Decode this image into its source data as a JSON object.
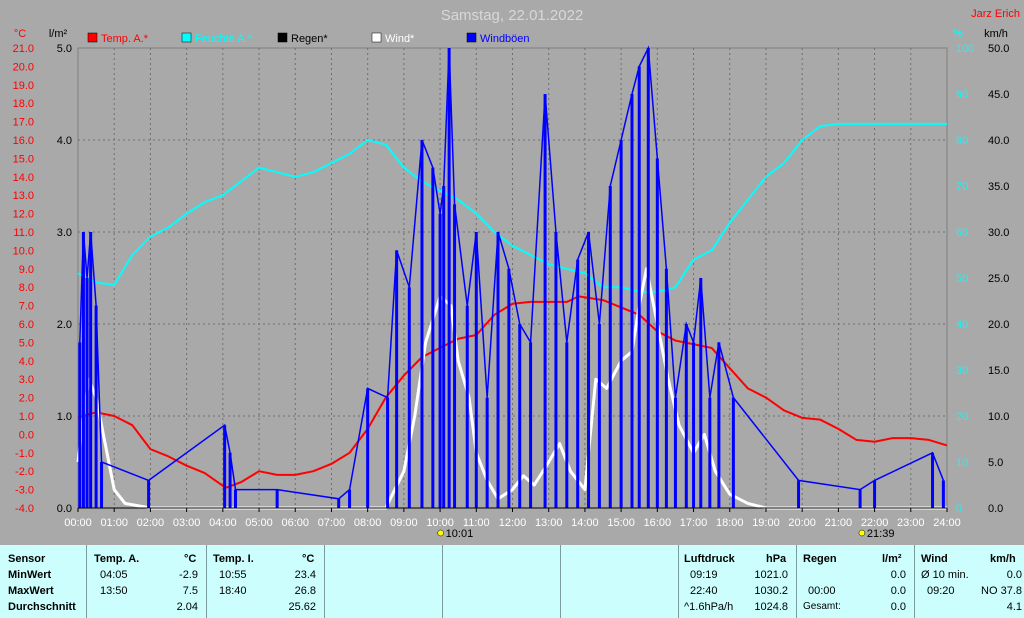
{
  "title": "Samstag, 22.01.2022",
  "author": "Jarz Erich",
  "colors": {
    "background": "#a9a9a9",
    "temperature": "#ff0000",
    "humidity": "#00ffff",
    "rain": "#000000",
    "wind": "#ffffff",
    "gusts": "#0000ff",
    "table": "#ccfefe"
  },
  "axes": {
    "temp_unit": "°C",
    "rain_unit": "l/m²",
    "humidity_unit": "%",
    "wind_unit": "km/h",
    "temp_ticks": [
      "21.0",
      "20.0",
      "19.0",
      "18.0",
      "17.0",
      "16.0",
      "15.0",
      "14.0",
      "13.0",
      "12.0",
      "11.0",
      "10.0",
      "9.0",
      "8.0",
      "7.0",
      "6.0",
      "5.0",
      "4.0",
      "3.0",
      "2.0",
      "1.0",
      "0.0",
      "-1.0",
      "-2.0",
      "-3.0",
      "-4.0"
    ],
    "rain_ticks": [
      "5.0",
      "4.0",
      "3.0",
      "2.0",
      "1.0",
      "0.0"
    ],
    "humidity_ticks": [
      "100",
      "90",
      "80",
      "70",
      "60",
      "50",
      "40",
      "30",
      "20",
      "10",
      "0"
    ],
    "wind_ticks": [
      "50.0",
      "45.0",
      "40.0",
      "35.0",
      "30.0",
      "25.0",
      "20.0",
      "15.0",
      "10.0",
      "5.0",
      "0.0"
    ],
    "time_ticks": [
      "00:00",
      "01:00",
      "02:00",
      "03:00",
      "04:00",
      "05:00",
      "06:00",
      "07:00",
      "08:00",
      "09:00",
      "10:00",
      "11:00",
      "12:00",
      "13:00",
      "14:00",
      "15:00",
      "16:00",
      "17:00",
      "18:00",
      "19:00",
      "20:00",
      "21:00",
      "22:00",
      "23:00",
      "24:00"
    ]
  },
  "markers": {
    "sunrise": "10:01",
    "sunset": "21:39"
  },
  "chart_data": {
    "type": "line",
    "title": "Samstag, 22.01.2022",
    "x_range_hours": [
      0,
      24
    ],
    "ylim_temp": [
      -4,
      21
    ],
    "ylim_rain": [
      0,
      5
    ],
    "ylim_humidity": [
      0,
      100
    ],
    "ylim_wind": [
      0,
      50
    ],
    "grid": true,
    "legend": "top",
    "series": [
      {
        "name": "Temp. A.*",
        "axis": "temp",
        "color": "#ff0000",
        "points": [
          [
            0,
            0.9
          ],
          [
            0.3,
            1.1
          ],
          [
            0.5,
            1.2
          ],
          [
            1,
            1.0
          ],
          [
            1.5,
            0.5
          ],
          [
            2,
            -0.8
          ],
          [
            2.5,
            -1.2
          ],
          [
            3,
            -1.7
          ],
          [
            3.5,
            -2.1
          ],
          [
            4.08,
            -2.9
          ],
          [
            4.5,
            -2.6
          ],
          [
            5,
            -2.0
          ],
          [
            5.5,
            -2.2
          ],
          [
            6,
            -2.2
          ],
          [
            6.5,
            -2.0
          ],
          [
            7,
            -1.6
          ],
          [
            7.5,
            -1.0
          ],
          [
            8,
            0.3
          ],
          [
            8.5,
            2.0
          ],
          [
            9,
            3.2
          ],
          [
            9.5,
            4.2
          ],
          [
            10,
            4.7
          ],
          [
            10.5,
            5.2
          ],
          [
            11,
            5.4
          ],
          [
            11.5,
            6.5
          ],
          [
            12,
            7.1
          ],
          [
            12.5,
            7.2
          ],
          [
            13,
            7.2
          ],
          [
            13.5,
            7.2
          ],
          [
            13.83,
            7.5
          ],
          [
            14.5,
            7.3
          ],
          [
            15,
            6.9
          ],
          [
            15.5,
            6.5
          ],
          [
            16,
            5.6
          ],
          [
            16.5,
            5.1
          ],
          [
            17,
            4.9
          ],
          [
            17.5,
            4.7
          ],
          [
            18,
            3.6
          ],
          [
            18.5,
            2.5
          ],
          [
            19,
            2.0
          ],
          [
            19.5,
            1.3
          ],
          [
            20,
            0.9
          ],
          [
            20.5,
            0.8
          ],
          [
            21,
            0.3
          ],
          [
            21.5,
            -0.3
          ],
          [
            22,
            -0.4
          ],
          [
            22.5,
            -0.2
          ],
          [
            23,
            -0.2
          ],
          [
            23.5,
            -0.3
          ],
          [
            24,
            -0.6
          ]
        ]
      },
      {
        "name": "Feuchte A.*",
        "axis": "humidity",
        "color": "#00ffff",
        "points": [
          [
            0,
            51
          ],
          [
            0.5,
            49
          ],
          [
            1,
            48.5
          ],
          [
            1.5,
            55
          ],
          [
            2,
            59
          ],
          [
            2.5,
            61
          ],
          [
            3,
            64
          ],
          [
            3.5,
            66.5
          ],
          [
            4,
            68
          ],
          [
            4.5,
            71
          ],
          [
            5,
            74
          ],
          [
            5.5,
            73
          ],
          [
            6,
            72
          ],
          [
            6.5,
            73
          ],
          [
            7,
            75
          ],
          [
            7.5,
            77
          ],
          [
            8,
            80
          ],
          [
            8.5,
            79
          ],
          [
            9,
            74
          ],
          [
            9.5,
            71
          ],
          [
            10,
            69
          ],
          [
            10.5,
            67
          ],
          [
            11,
            64
          ],
          [
            11.5,
            60
          ],
          [
            12,
            57
          ],
          [
            12.5,
            55
          ],
          [
            13,
            53
          ],
          [
            13.5,
            52
          ],
          [
            14,
            51
          ],
          [
            14.5,
            48
          ],
          [
            15,
            48
          ],
          [
            15.5,
            47
          ],
          [
            16,
            47
          ],
          [
            16.5,
            48
          ],
          [
            17,
            54
          ],
          [
            17.5,
            56
          ],
          [
            18,
            62
          ],
          [
            18.5,
            67
          ],
          [
            19,
            72
          ],
          [
            19.5,
            75
          ],
          [
            20,
            80
          ],
          [
            20.5,
            83
          ],
          [
            21,
            83.5
          ],
          [
            22,
            83.5
          ],
          [
            23,
            83.5
          ],
          [
            24,
            83.5
          ]
        ]
      },
      {
        "name": "Wind*",
        "axis": "wind",
        "color": "#ffffff",
        "points": [
          [
            0,
            5.0
          ],
          [
            0.15,
            10
          ],
          [
            0.3,
            14
          ],
          [
            0.5,
            12
          ],
          [
            0.7,
            8
          ],
          [
            1,
            2
          ],
          [
            1.3,
            0.5
          ],
          [
            2,
            0
          ],
          [
            8.5,
            0
          ],
          [
            9,
            4
          ],
          [
            9.3,
            10
          ],
          [
            9.6,
            18
          ],
          [
            10,
            23
          ],
          [
            10.3,
            22
          ],
          [
            10.5,
            16
          ],
          [
            10.8,
            12
          ],
          [
            11,
            6
          ],
          [
            11.3,
            3
          ],
          [
            11.6,
            1
          ],
          [
            12,
            2
          ],
          [
            12.3,
            3.5
          ],
          [
            12.6,
            2.5
          ],
          [
            13,
            5
          ],
          [
            13.3,
            7
          ],
          [
            13.6,
            4
          ],
          [
            14,
            2
          ],
          [
            14.3,
            14
          ],
          [
            14.6,
            13
          ],
          [
            15,
            16
          ],
          [
            15.3,
            17
          ],
          [
            15.5,
            22
          ],
          [
            15.7,
            26
          ],
          [
            16,
            20
          ],
          [
            16.3,
            14
          ],
          [
            16.6,
            9
          ],
          [
            17,
            6
          ],
          [
            17.3,
            8
          ],
          [
            17.6,
            4
          ],
          [
            18,
            1.5
          ],
          [
            18.5,
            0.5
          ],
          [
            19,
            0
          ],
          [
            24,
            0
          ]
        ]
      },
      {
        "name": "Windböen",
        "axis": "wind",
        "color": "#0000ff",
        "bars": [
          [
            0.05,
            18
          ],
          [
            0.15,
            30
          ],
          [
            0.25,
            25
          ],
          [
            0.35,
            30
          ],
          [
            0.5,
            22
          ],
          [
            0.65,
            5
          ],
          [
            1.95,
            3
          ],
          [
            4.05,
            9
          ],
          [
            4.2,
            6
          ],
          [
            4.35,
            2
          ],
          [
            5.5,
            2
          ],
          [
            7.2,
            1
          ],
          [
            7.5,
            2
          ],
          [
            8,
            13
          ],
          [
            8.55,
            12
          ],
          [
            8.8,
            28
          ],
          [
            9.15,
            24
          ],
          [
            9.5,
            40
          ],
          [
            9.8,
            37
          ],
          [
            10,
            32
          ],
          [
            10.1,
            35
          ],
          [
            10.25,
            50
          ],
          [
            10.4,
            33
          ],
          [
            10.75,
            22
          ],
          [
            11,
            30
          ],
          [
            11.3,
            12
          ],
          [
            11.6,
            30
          ],
          [
            11.9,
            26
          ],
          [
            12.2,
            20
          ],
          [
            12.5,
            18
          ],
          [
            12.9,
            45
          ],
          [
            13.2,
            30
          ],
          [
            13.5,
            18
          ],
          [
            13.8,
            27
          ],
          [
            14.1,
            30
          ],
          [
            14.4,
            20
          ],
          [
            14.7,
            35
          ],
          [
            15,
            40
          ],
          [
            15.3,
            45
          ],
          [
            15.5,
            48
          ],
          [
            15.75,
            50
          ],
          [
            16,
            38
          ],
          [
            16.25,
            26
          ],
          [
            16.5,
            12
          ],
          [
            16.8,
            20
          ],
          [
            17,
            18
          ],
          [
            17.2,
            25
          ],
          [
            17.45,
            12
          ],
          [
            17.7,
            18
          ],
          [
            18.1,
            12
          ],
          [
            19.9,
            3
          ],
          [
            21.6,
            2
          ],
          [
            22,
            3
          ],
          [
            23.6,
            6
          ],
          [
            23.9,
            3
          ]
        ]
      },
      {
        "name": "Regen*",
        "axis": "rain",
        "color": "#000000",
        "points": [
          [
            0,
            0
          ],
          [
            24,
            0
          ]
        ]
      }
    ]
  },
  "table": {
    "sensor": {
      "header": "Sensor",
      "min": "MinWert",
      "max": "MaxWert",
      "avg": "Durchschnitt"
    },
    "temp_a": {
      "header": "Temp. A.",
      "unit": "°C",
      "min_time": "04:05",
      "min_val": "-2.9",
      "max_time": "13:50",
      "max_val": "7.5",
      "avg": "2.04"
    },
    "temp_i": {
      "header": "Temp. I.",
      "unit": "°C",
      "min_time": "10:55",
      "min_val": "23.4",
      "max_time": "18:40",
      "max_val": "26.8",
      "avg": "25.62"
    },
    "pressure": {
      "header": "Luftdruck",
      "unit": "hPa",
      "min_time": "09:19",
      "min_val": "1021.0",
      "max_time": "22:40",
      "max_val": "1030.2",
      "avg_label": "^1.6hPa/h",
      "avg": "1024.8"
    },
    "rain": {
      "header": "Regen",
      "unit": "l/m²",
      "max_time": "00:00",
      "max_val": "0.0",
      "avg_label": "Gesamt:",
      "avg": "0.0",
      "min_val": "0.0"
    },
    "wind": {
      "header": "Wind",
      "unit": "km/h",
      "min_label": "Ø 10 min.",
      "min_val": "0.0",
      "max_time": "09:20",
      "max_val": "NO 37.8",
      "avg": "4.1"
    }
  }
}
